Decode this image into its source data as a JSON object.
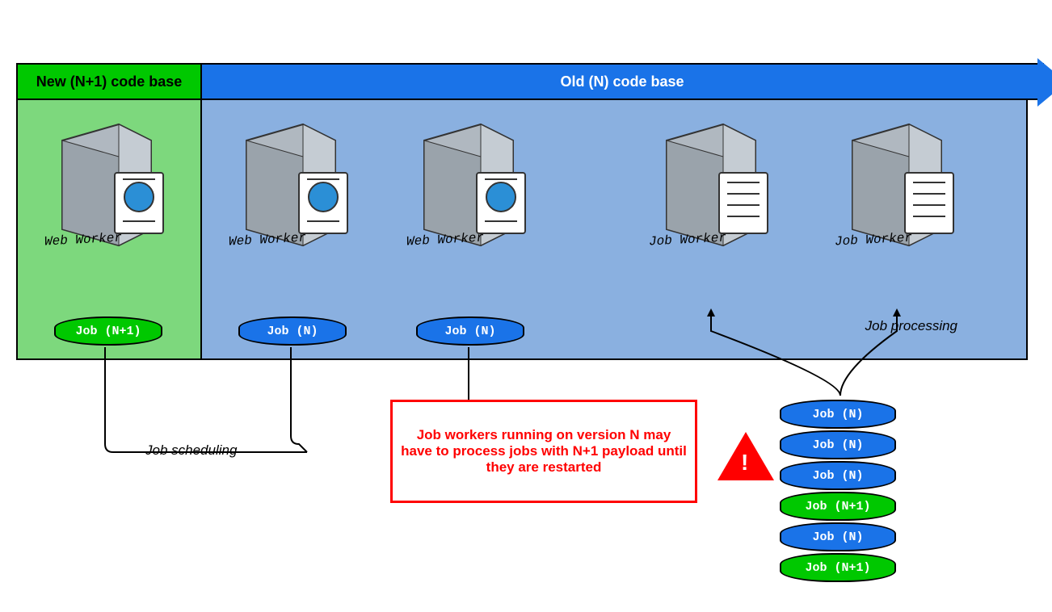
{
  "headers": {
    "new_label": "New (N+1) code base",
    "old_label": "Old (N) code base"
  },
  "servers": {
    "web_worker_label": "Web Worker",
    "job_worker_label": "Job Worker"
  },
  "jobs": {
    "new_job": "Job (N+1)",
    "old_job": "Job (N)"
  },
  "labels": {
    "scheduling": "Job scheduling",
    "processing": "Job processing"
  },
  "warning_text": "Job workers running on version N may have to process jobs with N+1 payload until they are restarted",
  "queue": [
    {
      "label": "Job (N)",
      "cls": "blue"
    },
    {
      "label": "Job (N)",
      "cls": "blue"
    },
    {
      "label": "Job (N)",
      "cls": "blue"
    },
    {
      "label": "Job (N+1)",
      "cls": "green"
    },
    {
      "label": "Job (N)",
      "cls": "blue"
    },
    {
      "label": "Job (N+1)",
      "cls": "green"
    }
  ]
}
